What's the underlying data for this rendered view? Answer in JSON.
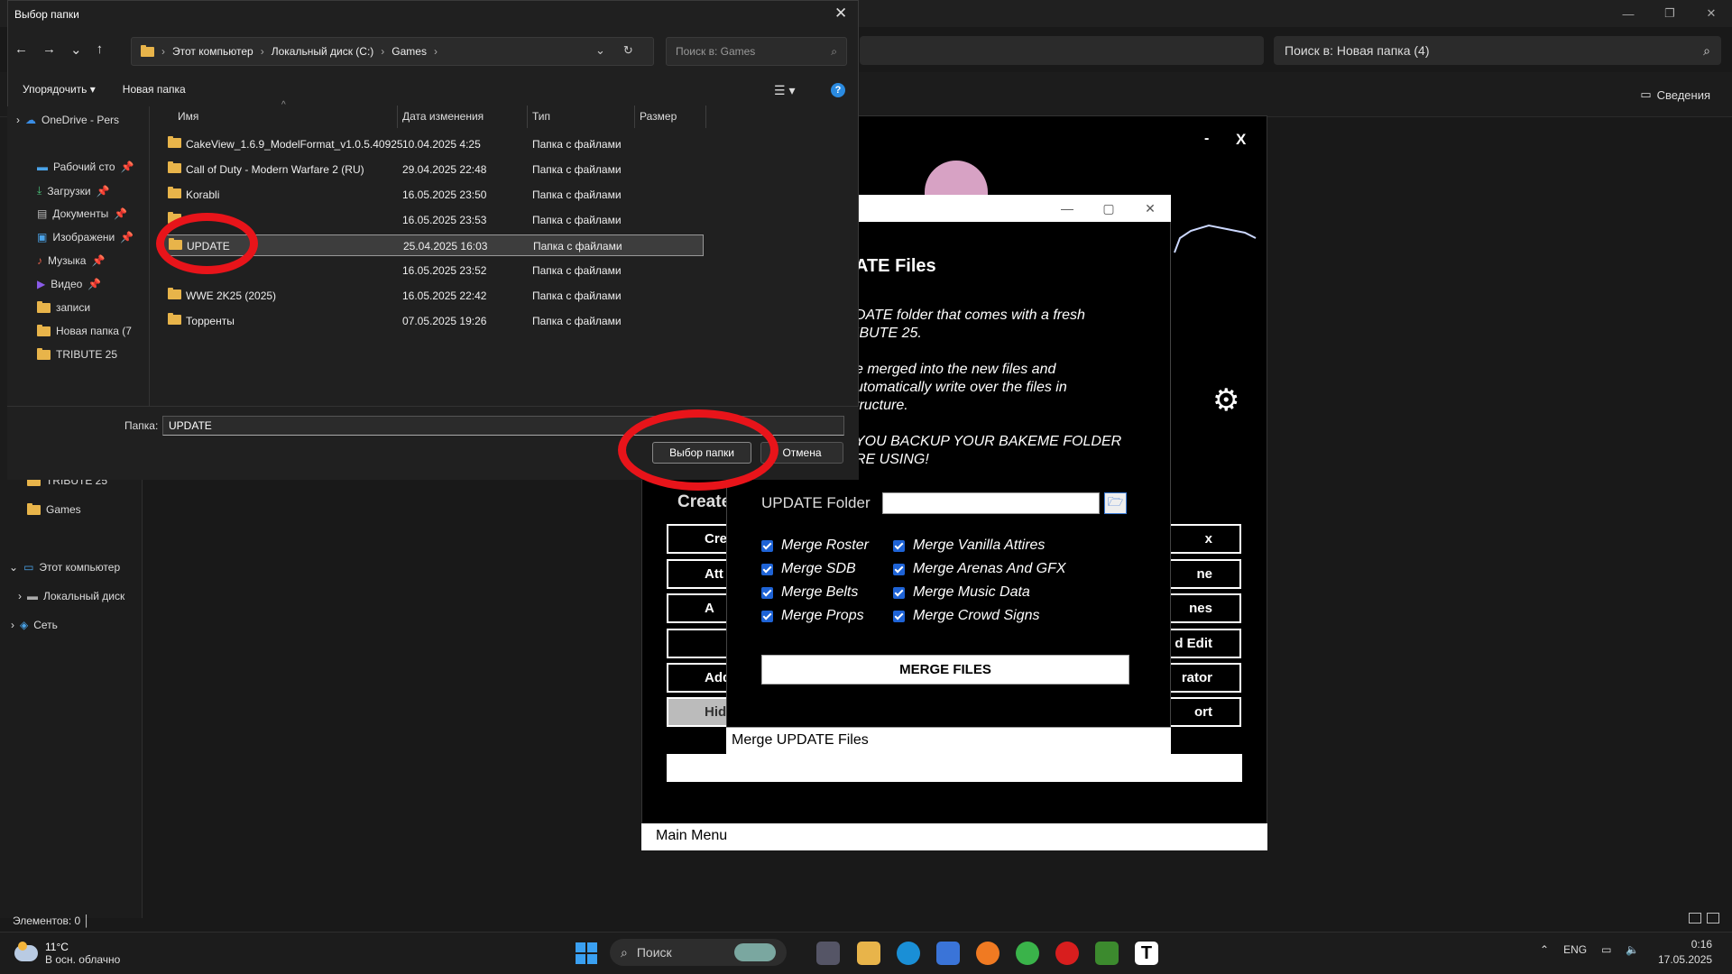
{
  "background_explorer": {
    "search": "Поиск в: Новая папка (4)",
    "details": "Сведения",
    "sidebar": [
      "TRIBUTE 25",
      "Games",
      "Этот компьютер",
      "Локальный диск",
      "Сеть"
    ],
    "status": "Элементов: 0"
  },
  "tool_app": {
    "min": "-",
    "close": "X",
    "create_heading": "Create",
    "left_buttons": [
      "Crea",
      "Att",
      "A",
      "",
      "Add",
      "Hidd"
    ],
    "right_buttons": [
      "x",
      "ne",
      "nes",
      "d Edit",
      "rator",
      "ort"
    ],
    "status": "Main Menu"
  },
  "merge_dialog": {
    "title": "ATE Files",
    "desc": [
      "DATE folder that comes with a fresh",
      "IBUTE 25.",
      "e merged into the new files and",
      "utomatically write over the files in",
      "tructure.",
      "YOU BACKUP YOUR BAKEME FOLDER",
      "RE USING!"
    ],
    "folder_label": "UPDATE Folder",
    "checks_left": [
      "Merge Roster",
      "Merge SDB",
      "Merge Belts",
      "Merge Props"
    ],
    "checks_right": [
      "Merge Vanilla Attires",
      "Merge Arenas And GFX",
      "Merge Music Data",
      "Merge Crowd Signs"
    ],
    "merge_button": "MERGE FILES",
    "status": "Merge UPDATE Files"
  },
  "picker": {
    "title": "Выбор папки",
    "breadcrumb": [
      "Этот компьютер",
      "Локальный диск (C:)",
      "Games"
    ],
    "search_placeholder": "Поиск в: Games",
    "organize": "Упорядочить",
    "new_folder": "Новая папка",
    "sidebar": [
      "OneDrive - Pers",
      "Рабочий сто",
      "Загрузки",
      "Документы",
      "Изображени",
      "Музыка",
      "Видео",
      "записи",
      "Новая папка (7",
      "TRIBUTE 25"
    ],
    "columns": [
      "Имя",
      "Дата изменения",
      "Тип",
      "Размер"
    ],
    "rows": [
      {
        "name": "CakeView_1.6.9_ModelFormat_v1.0.5.40925",
        "date": "10.04.2025 4:25",
        "type": "Папка с файлами"
      },
      {
        "name": "Call of Duty - Modern Warfare 2 (RU)",
        "date": "29.04.2025 22:48",
        "type": "Папка с файлами"
      },
      {
        "name": "Korabli",
        "date": "16.05.2025 23:50",
        "type": "Папка с файлами"
      },
      {
        "name": "",
        "date": "16.05.2025 23:53",
        "type": "Папка с файлами"
      },
      {
        "name": "UPDATE",
        "date": "25.04.2025 16:03",
        "type": "Папка с файлами"
      },
      {
        "name": "",
        "date": "16.05.2025 23:52",
        "type": "Папка с файлами"
      },
      {
        "name": "WWE 2K25 (2025)",
        "date": "16.05.2025 22:42",
        "type": "Папка с файлами"
      },
      {
        "name": "Торренты",
        "date": "07.05.2025 19:26",
        "type": "Папка с файлами"
      }
    ],
    "folder_label": "Папка:",
    "folder_value": "UPDATE",
    "select_button": "Выбор папки",
    "cancel_button": "Отмена"
  },
  "taskbar": {
    "temp": "11°C",
    "weather": "В осн. облачно",
    "search": "Поиск",
    "lang": "ENG",
    "time": "0:16",
    "date": "17.05.2025"
  }
}
